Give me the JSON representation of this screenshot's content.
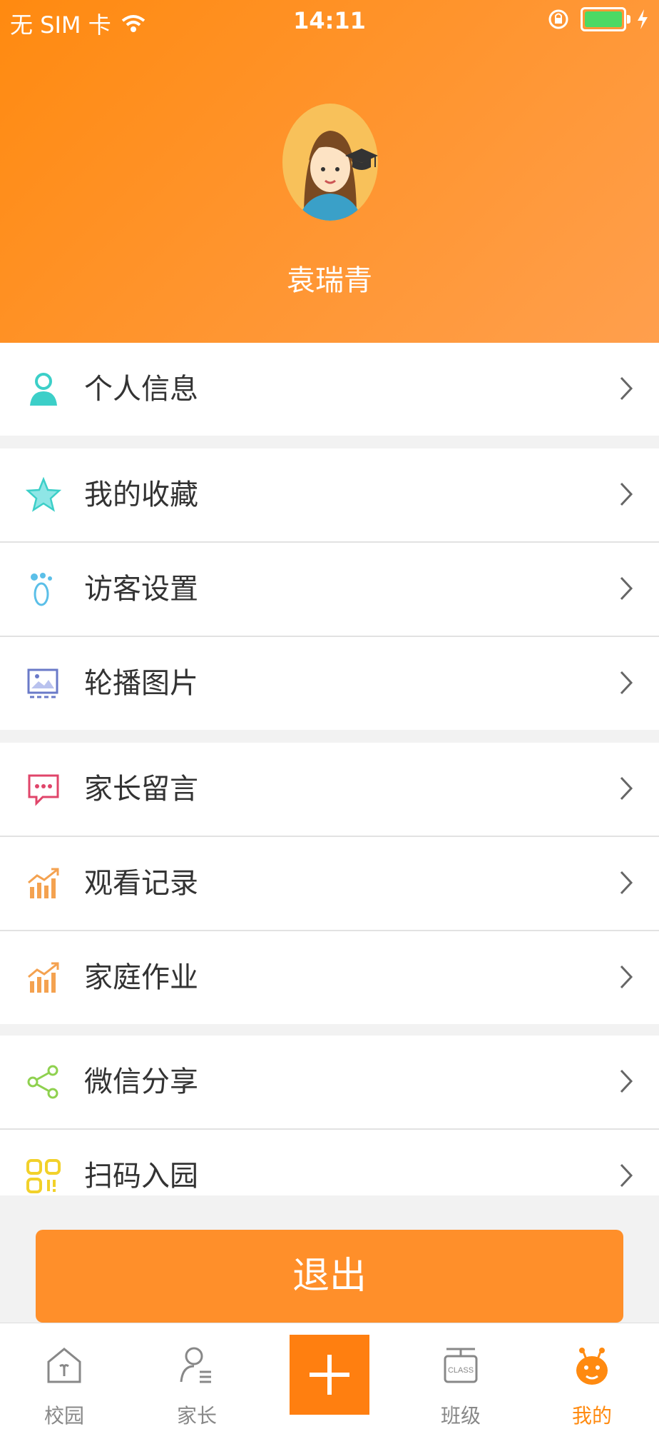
{
  "status_bar": {
    "carrier": "无 SIM 卡",
    "time": "14:11"
  },
  "profile": {
    "name": "袁瑞青"
  },
  "menu": [
    {
      "label": "个人信息",
      "icon": "person-icon"
    },
    {
      "label": "我的收藏",
      "icon": "star-icon"
    },
    {
      "label": "访客设置",
      "icon": "footprint-icon"
    },
    {
      "label": "轮播图片",
      "icon": "image-icon"
    },
    {
      "label": "家长留言",
      "icon": "message-icon"
    },
    {
      "label": "观看记录",
      "icon": "chart-icon"
    },
    {
      "label": "家庭作业",
      "icon": "chart-icon"
    },
    {
      "label": "微信分享",
      "icon": "share-icon"
    },
    {
      "label": "扫码入园",
      "icon": "qr-icon"
    }
  ],
  "logout_label": "退出",
  "tabs": [
    {
      "label": "校园"
    },
    {
      "label": "家长"
    },
    {
      "label": "班级"
    },
    {
      "label": "我的"
    }
  ],
  "class_icon_text": "CLASS",
  "colors": {
    "accent": "#ff8a10",
    "logout": "#ff8f2a",
    "battery": "#4cd964"
  }
}
